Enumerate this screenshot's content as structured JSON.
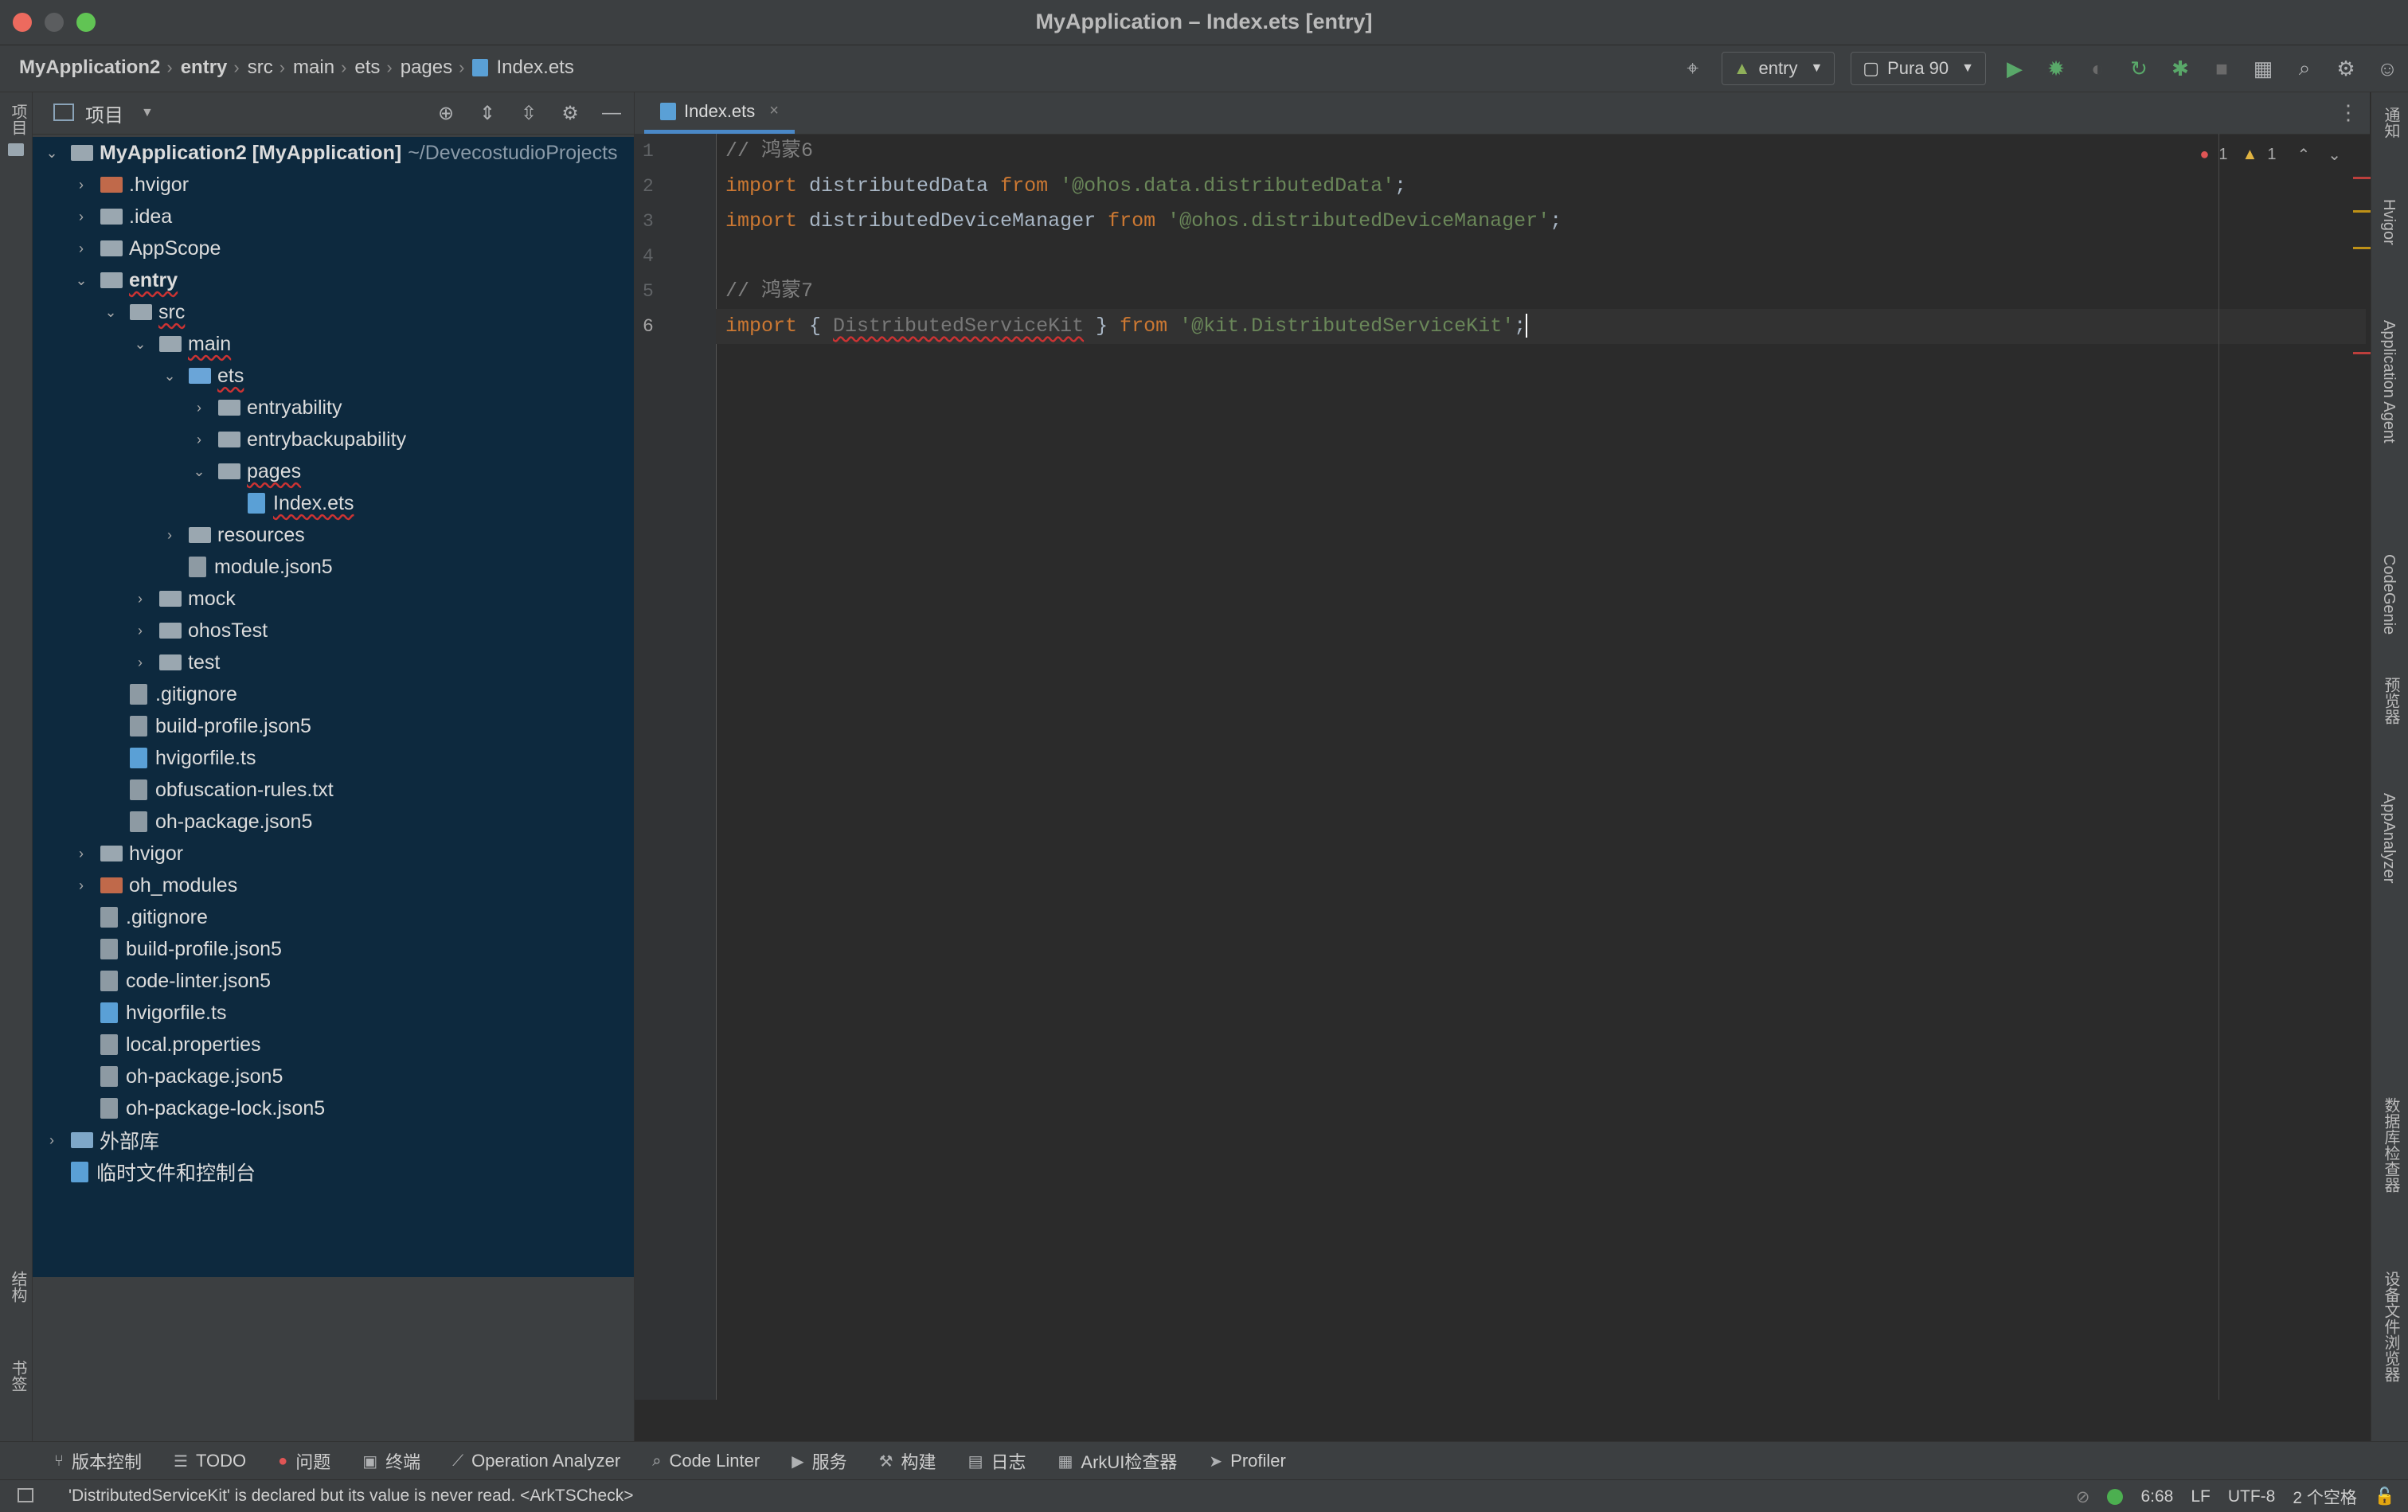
{
  "window": {
    "title": "MyApplication – Index.ets [entry]"
  },
  "breadcrumbs": [
    "MyApplication2",
    "entry",
    "src",
    "main",
    "ets",
    "pages",
    "Index.ets"
  ],
  "toolbar": {
    "module_select": "entry",
    "device_select": "Pura 90"
  },
  "project_panel": {
    "title": "项目",
    "tree": [
      {
        "label": "MyApplication2 [MyApplication]",
        "extra": "~/DevecostudioProjects",
        "depth": 0,
        "expanded": true,
        "kind": "module",
        "bold": true
      },
      {
        "label": ".hvigor",
        "depth": 1,
        "expanded": false,
        "kind": "folder-orange"
      },
      {
        "label": ".idea",
        "depth": 1,
        "expanded": false,
        "kind": "folder"
      },
      {
        "label": "AppScope",
        "depth": 1,
        "expanded": false,
        "kind": "folder"
      },
      {
        "label": "entry",
        "depth": 1,
        "expanded": true,
        "kind": "module",
        "bold": true,
        "error": true
      },
      {
        "label": "src",
        "depth": 2,
        "expanded": true,
        "kind": "folder",
        "error": true
      },
      {
        "label": "main",
        "depth": 3,
        "expanded": true,
        "kind": "folder",
        "error": true
      },
      {
        "label": "ets",
        "depth": 4,
        "expanded": true,
        "kind": "folder-blue",
        "error": true
      },
      {
        "label": "entryability",
        "depth": 5,
        "expanded": false,
        "kind": "folder"
      },
      {
        "label": "entrybackupability",
        "depth": 5,
        "expanded": false,
        "kind": "folder"
      },
      {
        "label": "pages",
        "depth": 5,
        "expanded": true,
        "kind": "folder",
        "error": true
      },
      {
        "label": "Index.ets",
        "depth": 6,
        "kind": "file-ets",
        "error": true
      },
      {
        "label": "resources",
        "depth": 4,
        "expanded": false,
        "kind": "folder"
      },
      {
        "label": "module.json5",
        "depth": 4,
        "kind": "file"
      },
      {
        "label": "mock",
        "depth": 3,
        "expanded": false,
        "kind": "folder"
      },
      {
        "label": "ohosTest",
        "depth": 3,
        "expanded": false,
        "kind": "folder"
      },
      {
        "label": "test",
        "depth": 3,
        "expanded": false,
        "kind": "folder"
      },
      {
        "label": ".gitignore",
        "depth": 2,
        "kind": "file"
      },
      {
        "label": "build-profile.json5",
        "depth": 2,
        "kind": "file"
      },
      {
        "label": "hvigorfile.ts",
        "depth": 2,
        "kind": "file-ts"
      },
      {
        "label": "obfuscation-rules.txt",
        "depth": 2,
        "kind": "file"
      },
      {
        "label": "oh-package.json5",
        "depth": 2,
        "kind": "file"
      },
      {
        "label": "hvigor",
        "depth": 1,
        "expanded": false,
        "kind": "folder"
      },
      {
        "label": "oh_modules",
        "depth": 1,
        "expanded": false,
        "kind": "folder-orange"
      },
      {
        "label": ".gitignore",
        "depth": 1,
        "kind": "file"
      },
      {
        "label": "build-profile.json5",
        "depth": 1,
        "kind": "file"
      },
      {
        "label": "code-linter.json5",
        "depth": 1,
        "kind": "file"
      },
      {
        "label": "hvigorfile.ts",
        "depth": 1,
        "kind": "file-ts"
      },
      {
        "label": "local.properties",
        "depth": 1,
        "kind": "file"
      },
      {
        "label": "oh-package.json5",
        "depth": 1,
        "kind": "file"
      },
      {
        "label": "oh-package-lock.json5",
        "depth": 1,
        "kind": "file"
      },
      {
        "label": "外部库",
        "depth": 0,
        "expanded": false,
        "kind": "library"
      },
      {
        "label": "临时文件和控制台",
        "depth": 0,
        "kind": "scratch"
      }
    ]
  },
  "left_stripe": {
    "project": "项目",
    "structure": "结构",
    "bookmarks": "书签"
  },
  "editor": {
    "tab": "Index.ets",
    "errors": "1",
    "warnings": "1",
    "lines": [
      {
        "n": "1",
        "comment": "// 鸿蒙6"
      },
      {
        "n": "2",
        "kw": "import",
        "name": " distributedData ",
        "kw2": "from",
        "str": " '@ohos.data.distributedData'",
        "end": ";"
      },
      {
        "n": "3",
        "kw": "import",
        "name": " distributedDeviceManager ",
        "kw2": "from",
        "str": " '@ohos.distributedDeviceManager'",
        "end": ";"
      },
      {
        "n": "4"
      },
      {
        "n": "5",
        "comment": "// 鸿蒙7"
      },
      {
        "n": "6",
        "kw": "import",
        "brace_open": " { ",
        "unused": "DistributedServiceKit",
        "brace_close": " } ",
        "kw2": "from",
        "str": " '@kit.DistributedServiceKit'",
        "end": ";"
      }
    ]
  },
  "right_stripe": [
    "通知",
    "Hvigor",
    "Application Agent",
    "CodeGenie",
    "预览器",
    "AppAnalyzer",
    "数据库检查器",
    "设备文件浏览器"
  ],
  "tool_windows": [
    "版本控制",
    "TODO",
    "问题",
    "终端",
    "Operation Analyzer",
    "Code Linter",
    "服务",
    "构建",
    "日志",
    "ArkUI检查器",
    "Profiler"
  ],
  "status": {
    "message": "'DistributedServiceKit' is declared but its value is never read. <ArkTSCheck>",
    "position": "6:68",
    "line_sep": "LF",
    "encoding": "UTF-8",
    "indent": "2 个空格"
  }
}
